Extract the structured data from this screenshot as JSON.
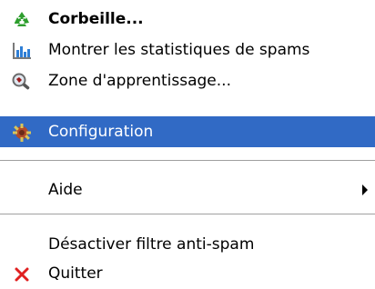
{
  "menu": {
    "items": [
      {
        "label": "Corbeille...",
        "icon": "recycle-icon"
      },
      {
        "label": "Montrer les statistiques de spams",
        "icon": "bar-chart-icon"
      },
      {
        "label": "Zone d'apprentissage...",
        "icon": "magnifier-icon"
      },
      {
        "label": "Configuration",
        "icon": "gear-icon",
        "selected": true
      },
      {
        "label": "Aide",
        "has_submenu": true
      },
      {
        "label": "Désactiver filtre anti-spam"
      },
      {
        "label": "Quitter",
        "icon": "close-icon"
      }
    ]
  },
  "colors": {
    "selection": "#316ac5",
    "recycle": "#2e9e2e",
    "chart": "#2f7fd6",
    "quit": "#e02020"
  }
}
